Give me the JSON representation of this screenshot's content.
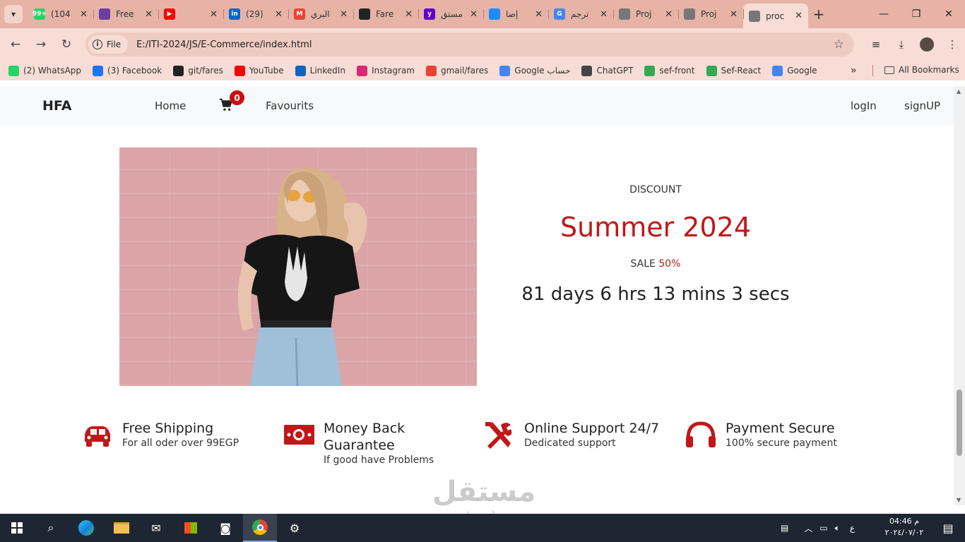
{
  "browser": {
    "tabs": [
      {
        "title": "(104",
        "color": "#25d366",
        "badge": "99+"
      },
      {
        "title": "Free",
        "color": "#6b3fa0",
        "badge": ""
      },
      {
        "title": "",
        "color": "#ff0000",
        "badge": "▶"
      },
      {
        "title": "(29)",
        "color": "#0a66c2",
        "badge": "in"
      },
      {
        "title": "البري",
        "color": "#ea4335",
        "badge": "M"
      },
      {
        "title": "Fare",
        "color": "#222222",
        "badge": ""
      },
      {
        "title": "مستق",
        "color": "#6001d2",
        "badge": "y"
      },
      {
        "title": "إضا",
        "color": "#1a8cff",
        "badge": ""
      },
      {
        "title": "ترجم",
        "color": "#4285f4",
        "badge": "G"
      },
      {
        "title": "Proj",
        "color": "#777777",
        "badge": ""
      },
      {
        "title": "Proj",
        "color": "#777777",
        "badge": ""
      },
      {
        "title": "proc",
        "color": "#777777",
        "badge": ""
      }
    ],
    "active_tab_index": 11,
    "new_tab_label": "+",
    "address_chip": "File",
    "url": "E:/ITI-2024/JS/E-Commerce/index.html",
    "bookmarks": [
      {
        "label": "(2) WhatsApp",
        "color": "#25d366"
      },
      {
        "label": "(3) Facebook",
        "color": "#1877f2"
      },
      {
        "label": "git/fares",
        "color": "#222222"
      },
      {
        "label": "YouTube",
        "color": "#ff0000"
      },
      {
        "label": "LinkedIn",
        "color": "#0a66c2"
      },
      {
        "label": "Instagram",
        "color": "#d62976"
      },
      {
        "label": "gmail/fares",
        "color": "#ea4335"
      },
      {
        "label": "Google حساب",
        "color": "#4285f4"
      },
      {
        "label": "ChatGPT",
        "color": "#444444"
      },
      {
        "label": "sef-front",
        "color": "#34a853"
      },
      {
        "label": "Sef-React",
        "color": "#34a853"
      },
      {
        "label": "Google",
        "color": "#4285f4"
      }
    ],
    "all_bookmarks": "All Bookmarks",
    "more_bookmarks": "»"
  },
  "site": {
    "brand": "HFA",
    "nav": {
      "home": "Home",
      "favourites": "Favourits",
      "login": "logIn",
      "signup": "signUP"
    },
    "cart_count": "0"
  },
  "promo": {
    "label": "DISCOUNT",
    "title": "Summer 2024",
    "sale_prefix": "SALE ",
    "sale_pct": "50%",
    "countdown": "81 days 6 hrs 13 mins 3 secs"
  },
  "features": [
    {
      "icon": "truck-icon",
      "title": "Free Shipping",
      "subtitle": "For all oder over 99EGP"
    },
    {
      "icon": "money-bill-icon",
      "title": "Money Back",
      "title2": "Guarantee",
      "subtitle": "If good have Problems"
    },
    {
      "icon": "tools-icon",
      "title": "Online Support 24/7",
      "subtitle": "Dedicated support"
    },
    {
      "icon": "headphones-icon",
      "title": "Payment Secure",
      "subtitle": "100% secure payment"
    }
  ],
  "watermark": {
    "arabic": "مستقل",
    "latin": "mostaql.com"
  },
  "taskbar": {
    "clock_time": "04:46 م",
    "clock_date": "٢٠٢٤/٠٧/٠٢",
    "lang": "ع"
  },
  "colors": {
    "accent": "#c01818",
    "tabbar": "#e6b3a6",
    "toolbar": "#f7ddd5"
  }
}
